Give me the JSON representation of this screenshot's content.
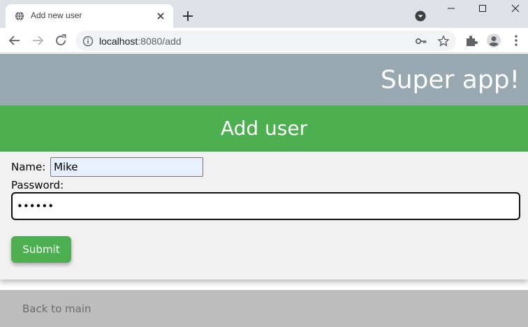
{
  "browser": {
    "tab_title": "Add new user",
    "url_host": "localhost",
    "url_path": ":8080/add"
  },
  "app": {
    "title": "Super app!"
  },
  "form": {
    "heading": "Add user",
    "name_label": "Name:",
    "name_value": "Mike",
    "password_label": "Password:",
    "password_value": "••••••",
    "submit_label": "Submit"
  },
  "footer": {
    "back_label": "Back to main"
  },
  "colors": {
    "header_bg": "#97a8b0",
    "accent": "#4caf50",
    "form_bg": "#f1f1f1",
    "footer_bg": "#bdbdbd"
  }
}
